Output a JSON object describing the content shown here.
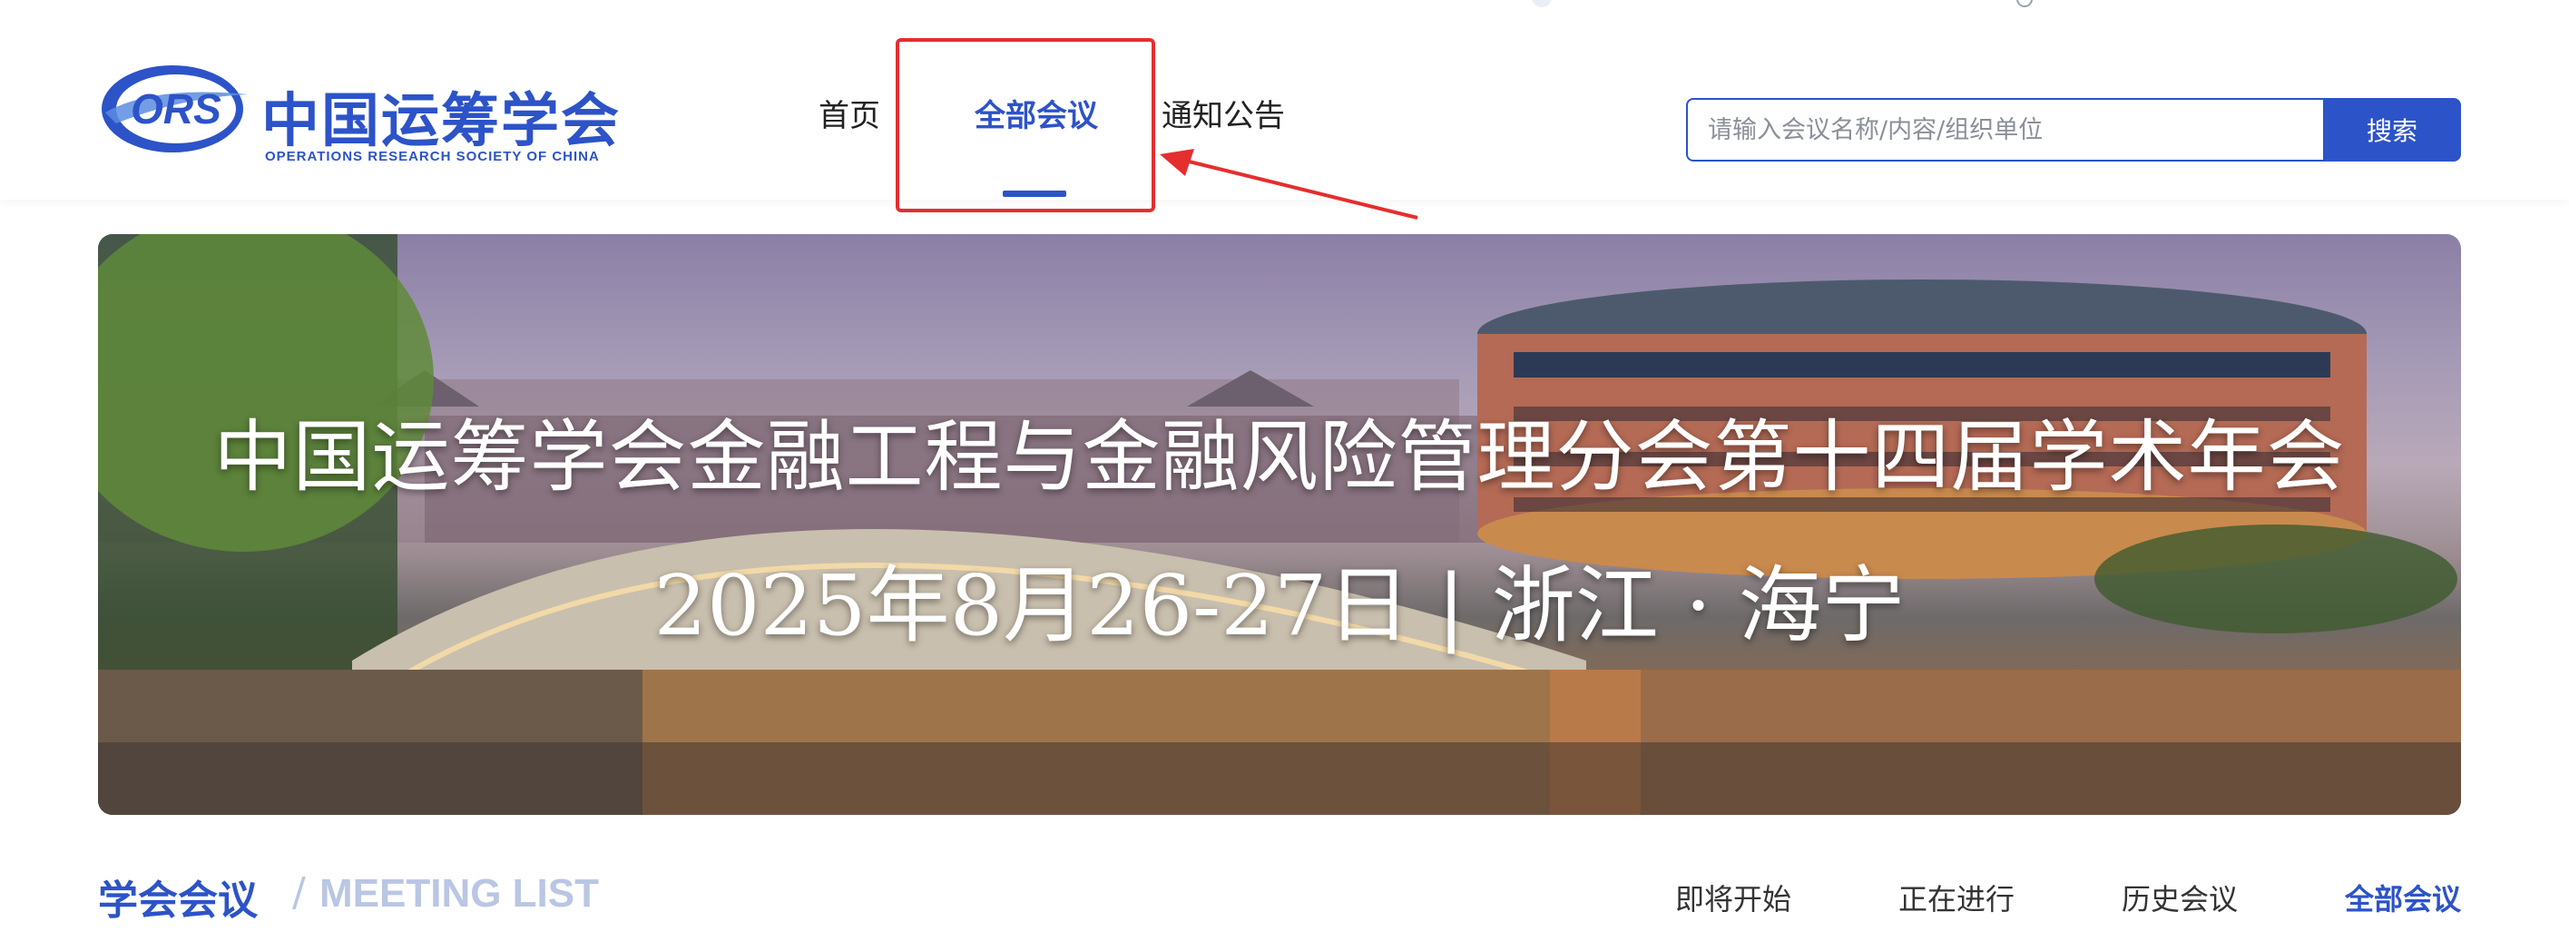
{
  "brand": {
    "logo_mark": "ORS",
    "name_cn": "中国运筹学会",
    "name_en": "OPERATIONS RESEARCH SOCIETY OF CHINA",
    "primary_color": "#2c53c8"
  },
  "nav": {
    "items": [
      {
        "label": "首页",
        "active": false
      },
      {
        "label": "全部会议",
        "active": true
      },
      {
        "label": "通知公告",
        "active": false
      }
    ]
  },
  "search": {
    "placeholder": "请输入会议名称/内容/组织单位",
    "button_label": "搜索"
  },
  "banner": {
    "title": "中国运筹学会金融工程与金融风险管理分会第十四届学术年会",
    "subtitle": "2025年8月26-27日 | 浙江 · 海宁"
  },
  "section": {
    "title": "学会会议",
    "separator": "/",
    "subtitle_en": "MEETING LIST",
    "filters": [
      {
        "label": "即将开始",
        "active": false
      },
      {
        "label": "正在进行",
        "active": false
      },
      {
        "label": "历史会议",
        "active": false
      },
      {
        "label": "全部会议",
        "active": true
      }
    ]
  },
  "annotation": {
    "highlight_color": "#e52e2e"
  }
}
